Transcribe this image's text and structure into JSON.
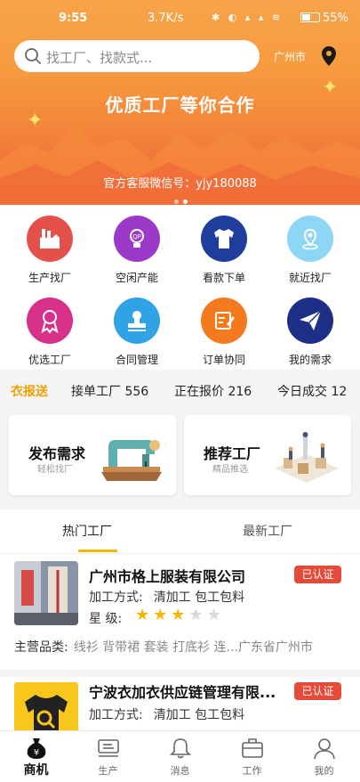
{
  "status_bar": {
    "time": "9:55",
    "network_speed": "3.7K/s",
    "battery": "55%",
    "battery_level": 0.55
  },
  "search": {
    "placeholder": "找工厂、找款式..."
  },
  "location": {
    "city": "广州市"
  },
  "banner": {
    "slogan": "优质工厂等你合作",
    "wechat_text": "官方客服微信号：yjy180088",
    "pages": 2,
    "active_page": 2
  },
  "grid": {
    "items": [
      {
        "label": "生产找厂",
        "icon": "factory-icon",
        "color": "#e4514b"
      },
      {
        "label": "空闲产能",
        "icon": "lightbulb-icon",
        "color": "#9b39c8"
      },
      {
        "label": "看款下单",
        "icon": "tshirt-icon",
        "color": "#1f3d9c"
      },
      {
        "label": "就近找厂",
        "icon": "map-pin-icon",
        "color": "#8ed6f5"
      },
      {
        "label": "优选工厂",
        "icon": "ribbon-icon",
        "color": "#d8318a"
      },
      {
        "label": "合同管理",
        "icon": "stamp-icon",
        "color": "#2fa3e3"
      },
      {
        "label": "订单协同",
        "icon": "edit-note-icon",
        "color": "#f37a1d"
      },
      {
        "label": "我的需求",
        "icon": "paper-plane-icon",
        "color": "#1d2f86"
      }
    ]
  },
  "ticker": {
    "brand": "衣报送",
    "stats": [
      {
        "label": "接单工厂",
        "value": "556"
      },
      {
        "label": "正在报价",
        "value": "216"
      },
      {
        "label": "今日成交",
        "value": "12"
      }
    ]
  },
  "cards": [
    {
      "title": "发布需求",
      "subtitle": "轻松找厂",
      "art": "sewing-machine-icon"
    },
    {
      "title": "推荐工厂",
      "subtitle": "精品推选",
      "art": "factory-line-icon"
    }
  ],
  "tabs": [
    {
      "label": "热门工厂",
      "active": true
    },
    {
      "label": "最新工厂",
      "active": false
    }
  ],
  "factories": [
    {
      "name": "广州市格上服装有限公司",
      "badge": "已认证",
      "process_label": "加工方式:",
      "process_value": "清加工 包工包料",
      "rating_label": "星  级:",
      "rating": 3,
      "rating_max": 5,
      "category_label": "主营品类:",
      "category_value": "线衫 背带裙 套装 打底衫 连...广东省广州市"
    },
    {
      "name": "宁波衣加衣供应链管理有限...",
      "badge": "已认证",
      "process_label": "加工方式:",
      "process_value": "清加工 包工包料"
    }
  ],
  "nav": [
    {
      "label": "商机",
      "icon": "money-bag-icon",
      "active": true
    },
    {
      "label": "生产",
      "icon": "sewing-icon",
      "active": false
    },
    {
      "label": "消息",
      "icon": "bell-icon",
      "active": false
    },
    {
      "label": "工作",
      "icon": "briefcase-icon",
      "active": false
    },
    {
      "label": "我的",
      "icon": "user-icon",
      "active": false
    }
  ],
  "colors": {
    "accent": "#f5b800",
    "banner_top": "#f7a44a",
    "banner_bottom": "#ef5d3a",
    "badge": "#e84a3a",
    "brand_text": "#f0a000"
  }
}
